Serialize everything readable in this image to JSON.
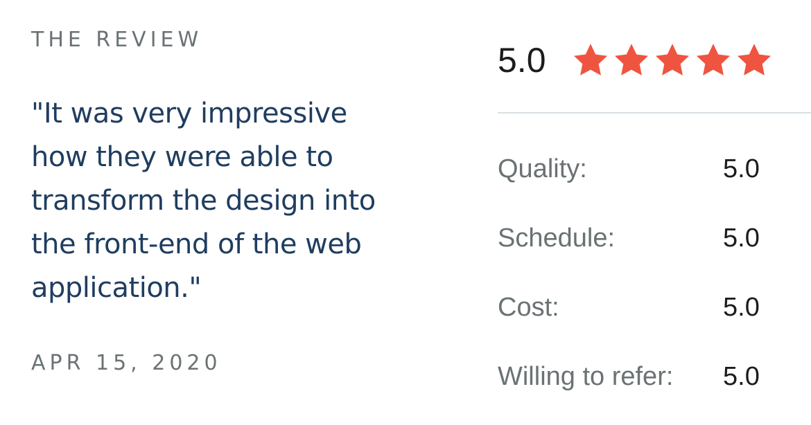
{
  "review": {
    "eyebrow": "THE REVIEW",
    "quote": "\"It was very impressive how they were able to transform the design into the front-end of the web application.\"",
    "date": "APR 15, 2020"
  },
  "rating": {
    "overall": "5.0",
    "stars": 5,
    "star_icon": "star-icon",
    "star_color": "#ef5440",
    "metrics": [
      {
        "label": "Quality:",
        "value": "5.0"
      },
      {
        "label": "Schedule:",
        "value": "5.0"
      },
      {
        "label": "Cost:",
        "value": "5.0"
      },
      {
        "label": "Willing to refer:",
        "value": "5.0"
      }
    ]
  }
}
